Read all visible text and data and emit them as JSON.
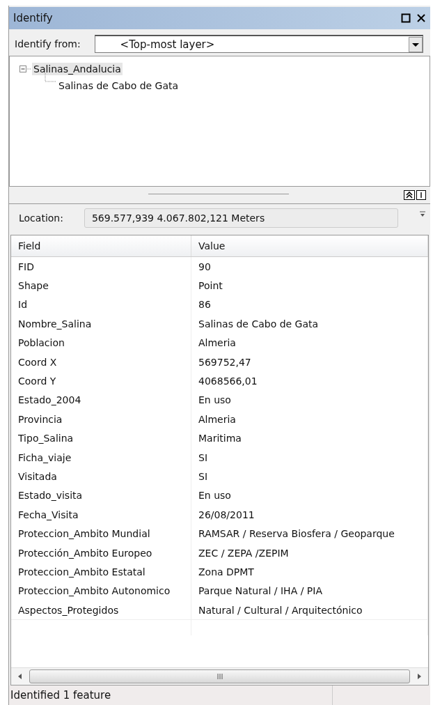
{
  "window": {
    "title": "Identify"
  },
  "identify_from": {
    "label": "Identify from:",
    "value": "<Top-most layer>"
  },
  "tree": [
    {
      "label": "Salinas_Andalucia",
      "selected": true,
      "expanded": true,
      "children": [
        {
          "label": "Salinas de Cabo de Gata",
          "selected": false
        }
      ]
    }
  ],
  "location": {
    "label": "Location:",
    "value": "569.577,939  4.067.802,121 Meters"
  },
  "table": {
    "columns": [
      "Field",
      "Value"
    ],
    "rows": [
      [
        "FID",
        "90"
      ],
      [
        "Shape",
        "Point"
      ],
      [
        "Id",
        "86"
      ],
      [
        "Nombre_Salina",
        "Salinas de Cabo de Gata"
      ],
      [
        "Poblacion",
        "Almeria"
      ],
      [
        "Coord X",
        "569752,47"
      ],
      [
        "Coord Y",
        "4068566,01"
      ],
      [
        "Estado_2004",
        "En uso"
      ],
      [
        "Provincia",
        "Almeria"
      ],
      [
        "Tipo_Salina",
        "Maritima"
      ],
      [
        "Ficha_viaje",
        "SI"
      ],
      [
        "Visitada",
        "SI"
      ],
      [
        "Estado_visita",
        "En uso"
      ],
      [
        "Fecha_Visita",
        "26/08/2011"
      ],
      [
        "Proteccion_Ambito Mundial",
        "RAMSAR / Reserva Biosfera / Geoparque"
      ],
      [
        "Protección_Ambito Europeo",
        "ZEC / ZEPA /ZEPIM"
      ],
      [
        "Proteccion_Ambito Estatal",
        "Zona DPMT"
      ],
      [
        "Proteccion_Ambito Autonomico",
        "Parque Natural / IHA / PIA"
      ],
      [
        "Aspectos_Protegidos",
        "Natural / Cultural / Arquitectónico"
      ]
    ]
  },
  "status_bar": "Identified 1 feature"
}
